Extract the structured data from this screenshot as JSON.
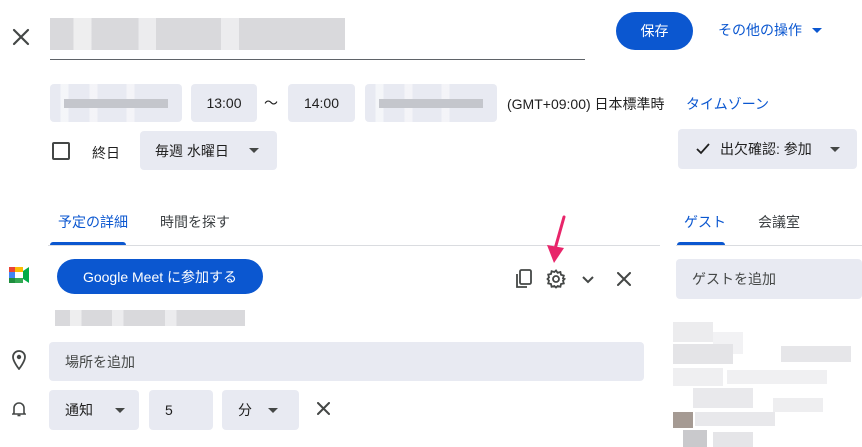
{
  "header": {
    "save_label": "保存",
    "more_actions_label": "その他の操作"
  },
  "datetime": {
    "start_time": "13:00",
    "separator": "〜",
    "end_time": "14:00",
    "timezone_label": "(GMT+09:00) 日本標準時",
    "timezone_link": "タイムゾーン"
  },
  "options": {
    "all_day_label": "終日",
    "recurrence_value": "毎週 水曜日",
    "rsvp_label": "出欠確認: 参加"
  },
  "tabs": {
    "details": "予定の詳細",
    "find_time": "時間を探す"
  },
  "meet": {
    "join_label": "Google Meet に参加する"
  },
  "location": {
    "placeholder": "場所を追加"
  },
  "notification": {
    "type_value": "通知",
    "amount_value": "5",
    "unit_value": "分"
  },
  "guests": {
    "tab_guests": "ゲスト",
    "tab_rooms": "会議室",
    "add_placeholder": "ゲストを追加"
  },
  "colors": {
    "accent": "#0b57d0",
    "annotation_arrow": "#e8256a"
  }
}
